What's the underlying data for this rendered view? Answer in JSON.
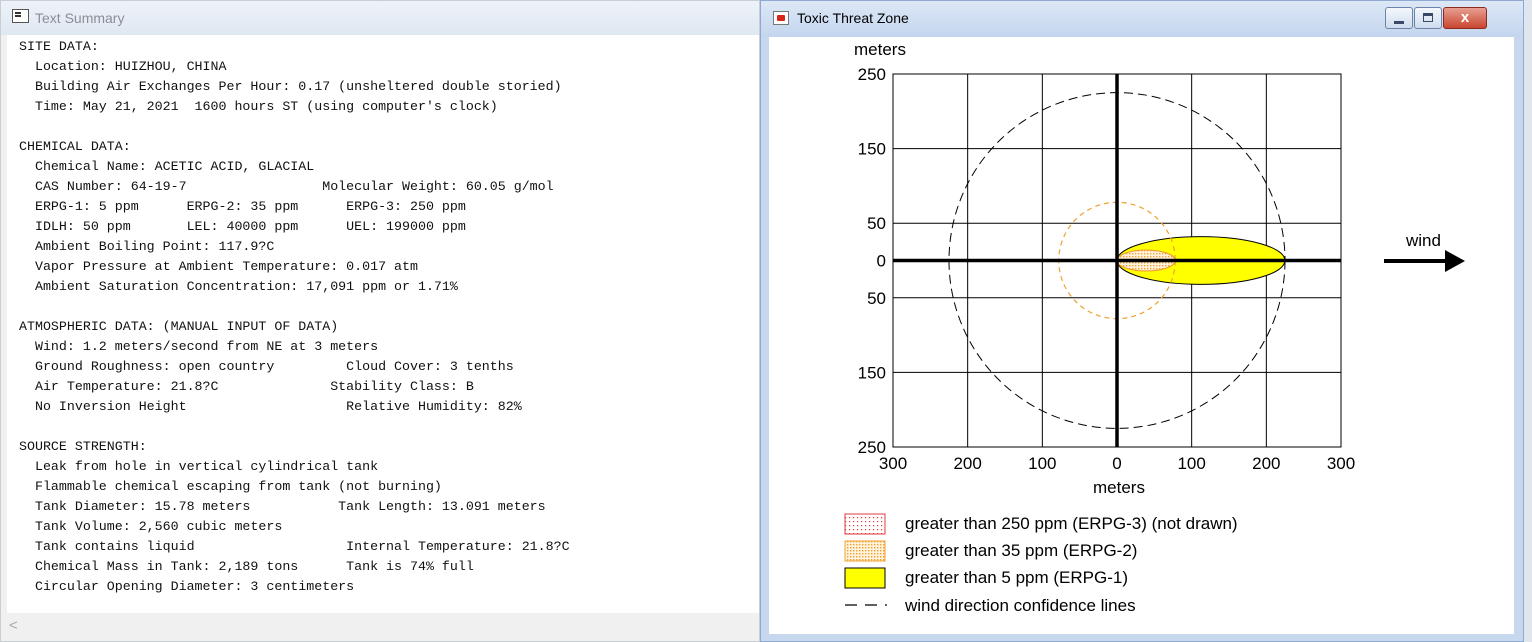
{
  "left_window": {
    "title": "Text Summary",
    "lines": [
      "SITE DATA:",
      "  Location: HUIZHOU, CHINA",
      "  Building Air Exchanges Per Hour: 0.17 (unsheltered double storied)",
      "  Time: May 21, 2021  1600 hours ST (using computer's clock)",
      "",
      "CHEMICAL DATA:",
      "  Chemical Name: ACETIC ACID, GLACIAL",
      "  CAS Number: 64-19-7                 Molecular Weight: 60.05 g/mol",
      "  ERPG-1: 5 ppm      ERPG-2: 35 ppm      ERPG-3: 250 ppm",
      "  IDLH: 50 ppm       LEL: 40000 ppm      UEL: 199000 ppm",
      "  Ambient Boiling Point: 117.9?C",
      "  Vapor Pressure at Ambient Temperature: 0.017 atm",
      "  Ambient Saturation Concentration: 17,091 ppm or 1.71%",
      "",
      "ATMOSPHERIC DATA: (MANUAL INPUT OF DATA)",
      "  Wind: 1.2 meters/second from NE at 3 meters",
      "  Ground Roughness: open country         Cloud Cover: 3 tenths",
      "  Air Temperature: 21.8?C              Stability Class: B",
      "  No Inversion Height                    Relative Humidity: 82%",
      "",
      "SOURCE STRENGTH:",
      "  Leak from hole in vertical cylindrical tank",
      "  Flammable chemical escaping from tank (not burning)",
      "  Tank Diameter: 15.78 meters           Tank Length: 13.091 meters",
      "  Tank Volume: 2,560 cubic meters",
      "  Tank contains liquid                   Internal Temperature: 21.8?C",
      "  Chemical Mass in Tank: 2,189 tons      Tank is 74% full",
      "  Circular Opening Diameter: 3 centimeters"
    ],
    "scroll_left_glyph": "<"
  },
  "right_window": {
    "title": "Toxic Threat Zone",
    "close_glyph": "x"
  },
  "chart_data": {
    "type": "scatter",
    "xlabel": "meters",
    "ylabel": "meters",
    "xlim": [
      -300,
      300
    ],
    "ylim": [
      -250,
      250
    ],
    "x_ticks": [
      -300,
      -200,
      -100,
      0,
      100,
      200,
      300
    ],
    "y_ticks": [
      250,
      150,
      50,
      0,
      -50,
      -150,
      -250
    ],
    "x_tick_labels": [
      "300",
      "200",
      "100",
      "0",
      "100",
      "200",
      "300"
    ],
    "y_tick_labels": [
      "250",
      "150",
      "50",
      "0",
      "50",
      "150",
      "250"
    ],
    "grid": true,
    "zones": [
      {
        "name": "greater than 250 ppm (ERPG-3) (not drawn)",
        "drawn": false,
        "color": "#e33b3b"
      },
      {
        "name": "greater than 35 ppm (ERPG-2)",
        "x_range": [
          0,
          78
        ],
        "half_width": 14,
        "color": "#f0a030",
        "circle_radius": 78
      },
      {
        "name": "greater than 5 ppm (ERPG-1)",
        "x_range": [
          0,
          225
        ],
        "half_width": 32,
        "color": "#ffff00"
      }
    ],
    "confidence": {
      "name": "wind direction confidence lines",
      "radius": 225
    },
    "wind_label": "wind",
    "legend_position": "bottom"
  }
}
